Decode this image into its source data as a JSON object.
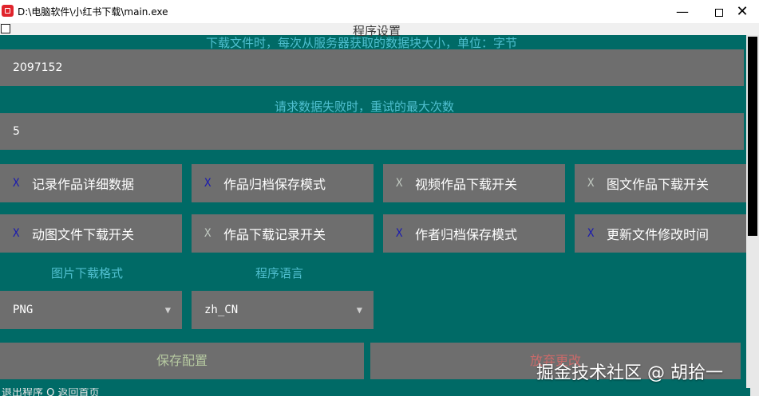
{
  "window": {
    "title": "D:\\电脑软件\\小红书下载\\main.exe",
    "minimize": "—",
    "close": "✕"
  },
  "page": {
    "title": "程序设置"
  },
  "chunk_size": {
    "label": "下载文件时，每次从服务器获取的数据块大小，单位：字节",
    "value": "2097152"
  },
  "retry": {
    "label": "请求数据失败时，重试的最大次数",
    "value": "5"
  },
  "toggles": [
    {
      "mark": "X",
      "enabled": true,
      "label": "记录作品详细数据"
    },
    {
      "mark": "X",
      "enabled": true,
      "label": "作品归档保存模式"
    },
    {
      "mark": "X",
      "enabled": false,
      "label": "视频作品下载开关"
    },
    {
      "mark": "X",
      "enabled": false,
      "label": "图文作品下载开关"
    },
    {
      "mark": "X",
      "enabled": true,
      "label": "动图文件下载开关"
    },
    {
      "mark": "X",
      "enabled": false,
      "label": "作品下载记录开关"
    },
    {
      "mark": "X",
      "enabled": true,
      "label": "作者归档保存模式"
    },
    {
      "mark": "X",
      "enabled": true,
      "label": "更新文件修改时间"
    }
  ],
  "image_format": {
    "label": "图片下载格式",
    "value": "PNG"
  },
  "language": {
    "label": "程序语言",
    "value": "zh_CN"
  },
  "buttons": {
    "save": "保存配置",
    "discard": "放弃更改"
  },
  "footer": {
    "text": "退出程序    Q  返回首页"
  },
  "watermark": "掘金技术社区 @ 胡拾一",
  "colors": {
    "background": "#006A66",
    "panel": "#6e6e6e",
    "label": "#4fbfcf",
    "save_text": "#b5c8a0",
    "discard_text": "#c96a6a",
    "mark_on": "#1b1bb0",
    "mark_off": "#c0c8c0"
  },
  "icons": {
    "app": "app-icon",
    "caret": "caret-down-icon",
    "checkbox": "checkbox-icon"
  }
}
